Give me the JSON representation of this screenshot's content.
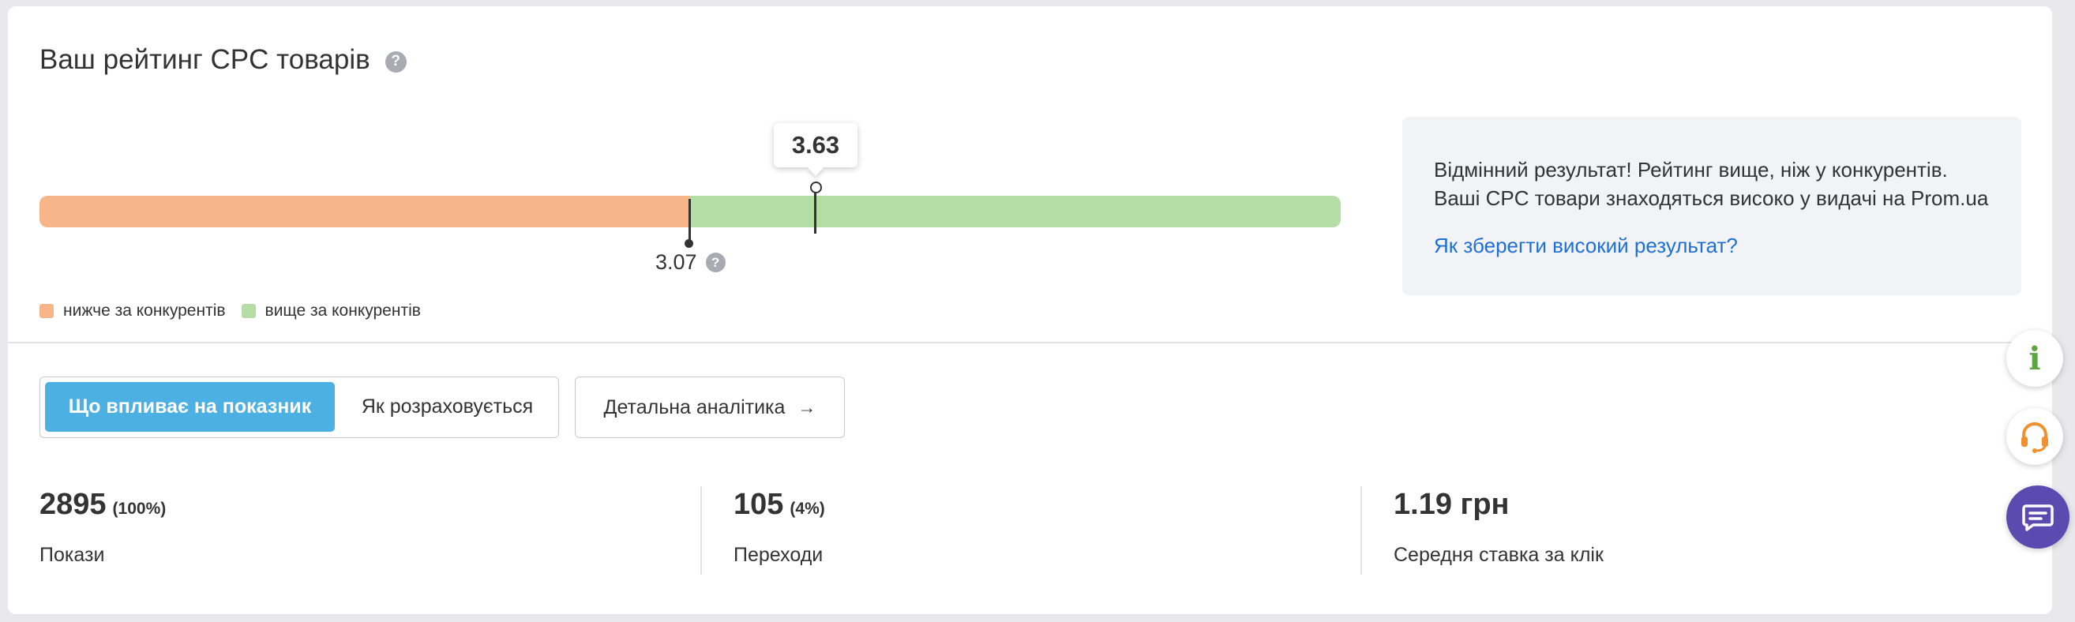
{
  "header": {
    "title": "Ваш рейтинг CPC товарів",
    "help_icon": "question-icon"
  },
  "rating": {
    "score": "3.63",
    "score_value": 3.63,
    "competitor_value": "3.07",
    "competitor_value_num": 3.07,
    "colors": {
      "below": "#f7b68a",
      "above": "#b4dea5"
    },
    "legend": {
      "below_label": "нижче за конкурентів",
      "above_label": "вище за конкурентів"
    }
  },
  "info": {
    "line1": "Відмінний результат! Рейтинг вище, ніж у конкурентів.",
    "line2": "Ваші CPC товари знаходяться високо у видачі на Prom.ua",
    "link": "Як зберегти високий результат?"
  },
  "tabs": {
    "active": "Що впливає на показник",
    "inactive": "Як розраховується"
  },
  "analytics_button": {
    "label": "Детальна аналітика",
    "icon": "→"
  },
  "stats": [
    {
      "value": "2895",
      "pct": "(100%)",
      "label": "Покази"
    },
    {
      "value": "105",
      "pct": "(4%)",
      "label": "Переходи"
    },
    {
      "value": "1.19 грн",
      "pct": "",
      "label": "Середня ставка за клік"
    }
  ],
  "floating": {
    "info_icon": "i",
    "colors": {
      "info": "#5aa73e",
      "support": "#f0902e",
      "chat": "#5b4bb0"
    }
  }
}
